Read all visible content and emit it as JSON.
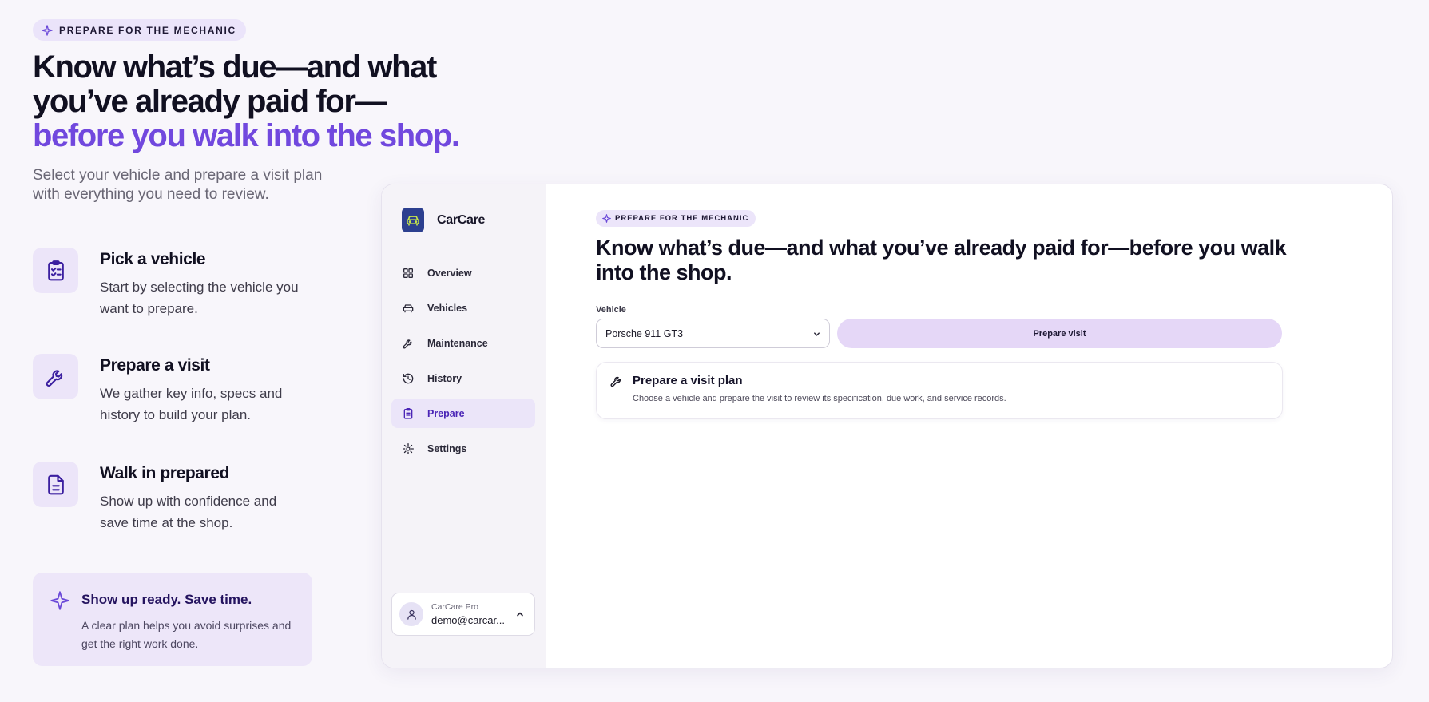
{
  "hero": {
    "eyebrow": "PREPARE FOR THE MECHANIC",
    "headline_line1": "Know what’s due—and what",
    "headline_line2": "you’ve already paid for—",
    "headline_accent": "before you walk into the shop.",
    "subtitle": "Select your vehicle and prepare a visit plan with everything you need to review."
  },
  "features": [
    {
      "title": "Pick a vehicle",
      "description": "Start by selecting the vehicle you want to prepare.",
      "icon": "clipboard-check-icon"
    },
    {
      "title": "Prepare a visit",
      "description": "We gather key info, specs and history to build your plan.",
      "icon": "wrench-icon"
    },
    {
      "title": "Walk in prepared",
      "description": "Show up with confidence and save time at the shop.",
      "icon": "document-icon"
    }
  ],
  "promo": {
    "title": "Show up ready. Save time.",
    "description": "A clear plan helps you avoid surprises and get the right work done."
  },
  "app": {
    "brand": "CarCare",
    "nav": [
      {
        "label": "Overview",
        "icon": "grid-icon",
        "active": false
      },
      {
        "label": "Vehicles",
        "icon": "car-icon",
        "active": false
      },
      {
        "label": "Maintenance",
        "icon": "wrench-icon",
        "active": false
      },
      {
        "label": "History",
        "icon": "history-icon",
        "active": false
      },
      {
        "label": "Prepare",
        "icon": "clipboard-icon",
        "active": true
      },
      {
        "label": "Settings",
        "icon": "gear-icon",
        "active": false
      }
    ],
    "user": {
      "plan": "CarCare Pro",
      "email": "demo@carcar..."
    },
    "main": {
      "eyebrow": "PREPARE FOR THE MECHANIC",
      "title": "Know what’s due—and what you’ve already paid for—before you walk into the shop.",
      "vehicle_label": "Vehicle",
      "vehicle_selected": "Porsche 911 GT3",
      "prepare_button": "Prepare visit",
      "card_title": "Prepare a visit plan",
      "card_description": "Choose a vehicle and prepare the visit to review its specification, due work, and service records."
    }
  },
  "colors": {
    "accent": "#7148de",
    "pill_bg": "#ebe4fa",
    "active_nav": "#4a25b6",
    "button_bg": "#e5d7f7"
  }
}
